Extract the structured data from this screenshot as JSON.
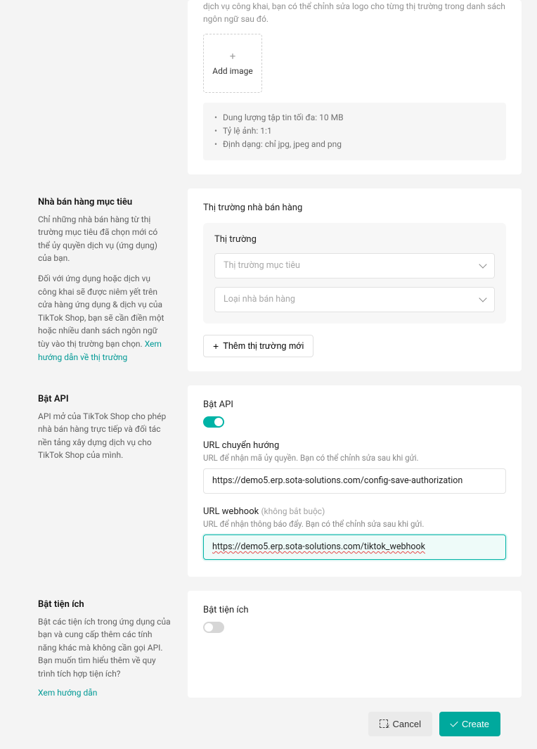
{
  "upload": {
    "truncated_text": "dịch vụ công khai, bạn có thể chỉnh sửa logo cho từng thị trường trong danh sách ngôn ngữ sau đó.",
    "add_image_label": "Add image",
    "notice": {
      "item1": "Dung lượng tập tin tối đa: 10 MB",
      "item2": "Tỷ lệ ảnh: 1:1",
      "item3": "Định dạng: chỉ jpg, jpeg and png"
    }
  },
  "target_seller": {
    "title": "Nhà bán hàng mục tiêu",
    "desc1": "Chỉ những nhà bán hàng từ thị trường mục tiêu đã chọn mới có thể ủy quyền dịch vụ (ứng dụng) của bạn.",
    "desc2": "Đối với ứng dụng hoặc dịch vụ công khai sẽ được niêm yết trên cửa hàng ứng dụng & dịch vụ của TikTok Shop, bạn sẽ cần điền một hoặc nhiều danh sách ngôn ngữ tùy vào thị trường bạn chọn. ",
    "link_text": "Xem hướng dẫn về thị trường",
    "panel_title": "Thị trường nhà bán hàng",
    "market_label": "Thị trường",
    "select1_placeholder": "Thị trường mục tiêu",
    "select2_placeholder": "Loại nhà bán hàng",
    "add_market_btn": "Thêm thị trường mới"
  },
  "api": {
    "title": "Bật API",
    "desc": "API mở của TikTok Shop cho phép nhà bán hàng trực tiếp và đối tác nền tảng xây dựng dịch vụ cho TikTok Shop của mình.",
    "panel_toggle_label": "Bật API",
    "redirect_label": "URL chuyển hướng",
    "redirect_hint": "URL để nhận mã ủy quyền. Bạn có thể chỉnh sửa sau khi gửi.",
    "redirect_value": "https://demo5.erp.sota-solutions.com/config-save-authorization",
    "webhook_label": "URL webhook",
    "webhook_optional": "(không bắt buộc)",
    "webhook_hint": "URL để nhận thông báo đẩy. Bạn có thể chỉnh sửa sau khi gửi.",
    "webhook_value": "https://demo5.erp.sota-solutions.com/tiktok_webhook"
  },
  "widget": {
    "title": "Bật tiện ích",
    "desc": "Bật các tiện ích trong ứng dụng của bạn và cung cấp thêm các tính năng khác mà không cần gọi API. Bạn muốn tìm hiểu thêm về quy trình tích hợp tiện ích?",
    "link_text": "Xem hướng dẫn",
    "panel_label": "Bật tiện ích"
  },
  "footer": {
    "cancel": "Cancel",
    "create": "Create"
  }
}
